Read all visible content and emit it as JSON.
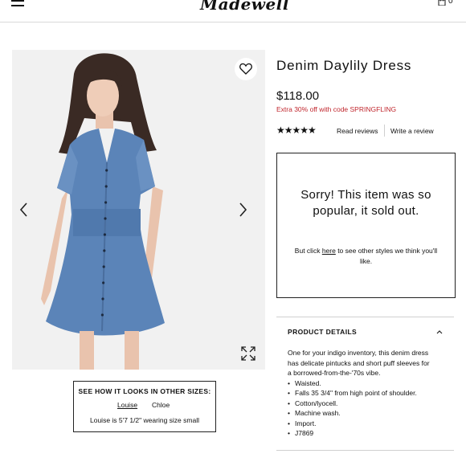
{
  "header": {
    "logo": "Madewell",
    "bag_count": "0"
  },
  "product": {
    "title": "Denim Daylily Dress",
    "price": "$118.00",
    "promo": "Extra 30% off with code SPRINGFLING",
    "rating": 4.5,
    "rating_stars": "★★★★★",
    "read_reviews": "Read reviews",
    "write_review": "Write a review"
  },
  "sold_out": {
    "message": "Sorry! This item was so popular, it sold out.",
    "sub_before": "But click ",
    "sub_link": "here",
    "sub_after": " to see other styles we think you'll like."
  },
  "sizes": {
    "title": "SEE HOW IT LOOKS IN OTHER SIZES:",
    "options": [
      "Louise",
      "Chloe"
    ],
    "note": "Louise is 5'7 1/2\" wearing size small"
  },
  "details": {
    "heading": "PRODUCT DETAILS",
    "description": "One for your indigo inventory, this denim dress has delicate pintucks and short puff sleeves for a borrowed-from-the-'70s vibe.",
    "bullets": [
      "Waisted.",
      "Falls 35 3/4\" from high point of shoulder.",
      "Cotton/lyocell.",
      "Machine wash.",
      "Import.",
      "J7869"
    ]
  },
  "colors": {
    "promo": "#c0262d",
    "denim": "#5b84b8",
    "panel_bg": "#f1f1f1"
  }
}
